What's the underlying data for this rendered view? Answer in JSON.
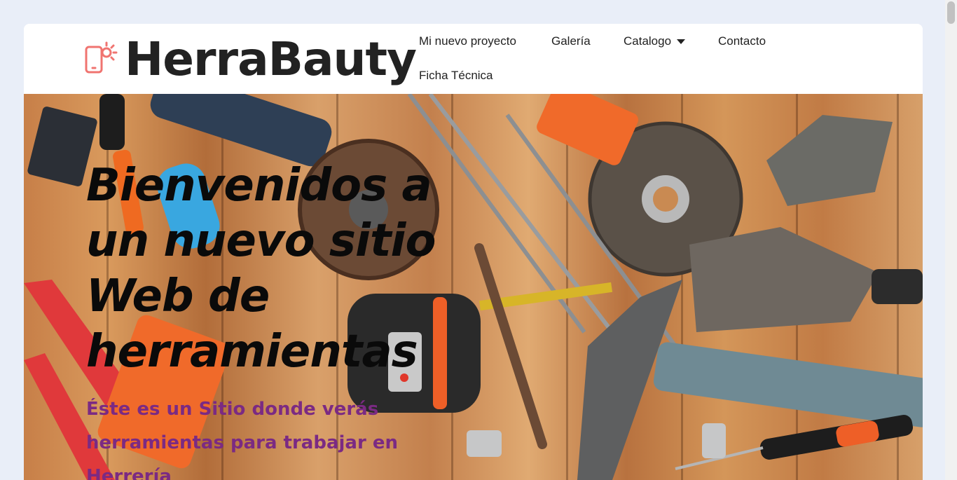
{
  "brand": {
    "name": "HerraBauty",
    "icon": "phone-light-icon",
    "icon_color": "#f07470"
  },
  "nav": {
    "items": [
      {
        "label": "Mi nuevo proyecto"
      },
      {
        "label": "Galería"
      },
      {
        "label": "Catalogo",
        "has_dropdown": true
      },
      {
        "label": "Contacto"
      },
      {
        "label": "Ficha Técnica"
      }
    ]
  },
  "hero": {
    "title": "Bienvenidos a un nuevo sitio Web de herramientas",
    "subtitle": "Éste es un Sitio donde verás herramientas para trabajar en Herrería",
    "title_color": "#0a0a0a",
    "subtitle_color": "#7b2a83"
  },
  "colors": {
    "page_background": "#e9eef8",
    "header_background": "#ffffff"
  }
}
